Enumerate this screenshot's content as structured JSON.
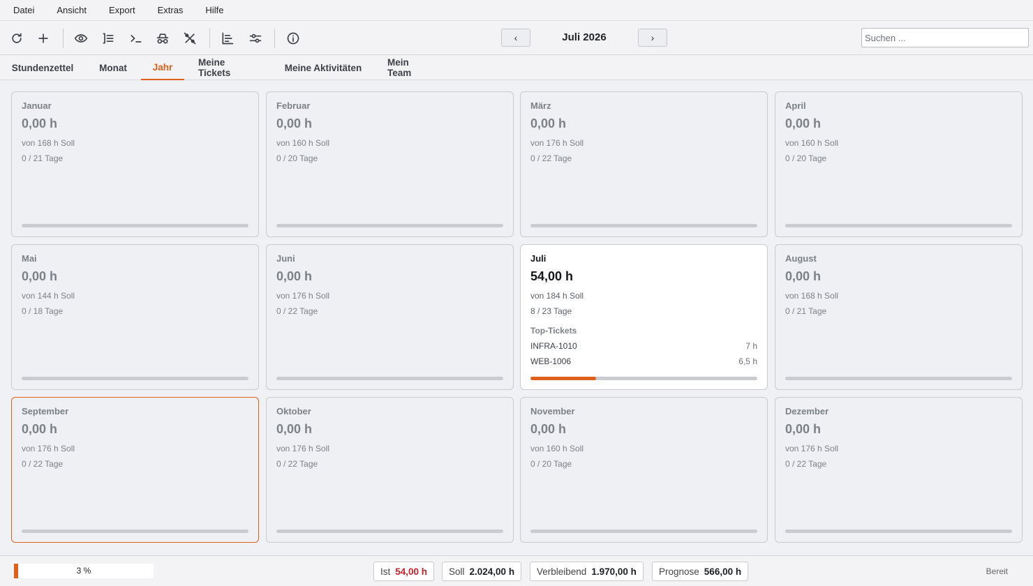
{
  "menu": {
    "items": [
      "Datei",
      "Ansicht",
      "Export",
      "Extras",
      "Hilfe"
    ]
  },
  "toolbar": {
    "icons": [
      "refresh-icon",
      "add-icon",
      "eye-icon",
      "list-icon",
      "terminal-icon",
      "incognito-icon",
      "percent-off-icon",
      "gantt-icon",
      "sliders-icon",
      "info-icon"
    ],
    "prev_label": "‹",
    "next_label": "›",
    "period": "Juli 2026",
    "search_placeholder": "Suchen ..."
  },
  "tabs": [
    {
      "label": "Stundenzettel",
      "active": false
    },
    {
      "label": "Monat",
      "active": false
    },
    {
      "label": "Jahr",
      "active": true
    },
    {
      "label": "Meine Tickets",
      "active": false
    },
    {
      "label": "Meine Aktivitäten",
      "active": false
    },
    {
      "label": "Mein Team",
      "active": false
    }
  ],
  "months": [
    {
      "name": "Januar",
      "hours": "0,00 h",
      "soll": "von 168 h Soll",
      "days": "0 / 21 Tage",
      "progress": 0
    },
    {
      "name": "Februar",
      "hours": "0,00 h",
      "soll": "von 160 h Soll",
      "days": "0 / 20 Tage",
      "progress": 0
    },
    {
      "name": "März",
      "hours": "0,00 h",
      "soll": "von 176 h Soll",
      "days": "0 / 22 Tage",
      "progress": 0
    },
    {
      "name": "April",
      "hours": "0,00 h",
      "soll": "von 160 h Soll",
      "days": "0 / 20 Tage",
      "progress": 0
    },
    {
      "name": "Mai",
      "hours": "0,00 h",
      "soll": "von 144 h Soll",
      "days": "0 / 18 Tage",
      "progress": 0
    },
    {
      "name": "Juni",
      "hours": "0,00 h",
      "soll": "von 176 h Soll",
      "days": "0 / 22 Tage",
      "progress": 0
    },
    {
      "name": "Juli",
      "hours": "54,00 h",
      "soll": "von 184 h Soll",
      "days": "8 / 23 Tage",
      "progress": 0.29,
      "current": true,
      "top_tickets_title": "Top-Tickets",
      "top_tickets": [
        {
          "id": "INFRA-1010",
          "hours": "7 h"
        },
        {
          "id": "WEB-1006",
          "hours": "6,5 h"
        }
      ]
    },
    {
      "name": "August",
      "hours": "0,00 h",
      "soll": "von 168 h Soll",
      "days": "0 / 21 Tage",
      "progress": 0
    },
    {
      "name": "September",
      "hours": "0,00 h",
      "soll": "von 176 h Soll",
      "days": "0 / 22 Tage",
      "progress": 0,
      "selected": true
    },
    {
      "name": "Oktober",
      "hours": "0,00 h",
      "soll": "von 176 h Soll",
      "days": "0 / 22 Tage",
      "progress": 0
    },
    {
      "name": "November",
      "hours": "0,00 h",
      "soll": "von 160 h Soll",
      "days": "0 / 20 Tage",
      "progress": 0
    },
    {
      "name": "Dezember",
      "hours": "0,00 h",
      "soll": "von 176 h Soll",
      "days": "0 / 22 Tage",
      "progress": 0
    }
  ],
  "status": {
    "progress_percent": 3,
    "progress_label": "3 %",
    "ist_label": "Ist",
    "ist_value": "54,00 h",
    "soll_label": "Soll",
    "soll_value": "2.024,00 h",
    "verbleibend_label": "Verbleibend",
    "verbleibend_value": "1.970,00 h",
    "prognose_label": "Prognose",
    "prognose_value": "566,00 h",
    "ready": "Bereit"
  },
  "colors": {
    "accent": "#e0601a",
    "ist_value": "#c8202b"
  }
}
